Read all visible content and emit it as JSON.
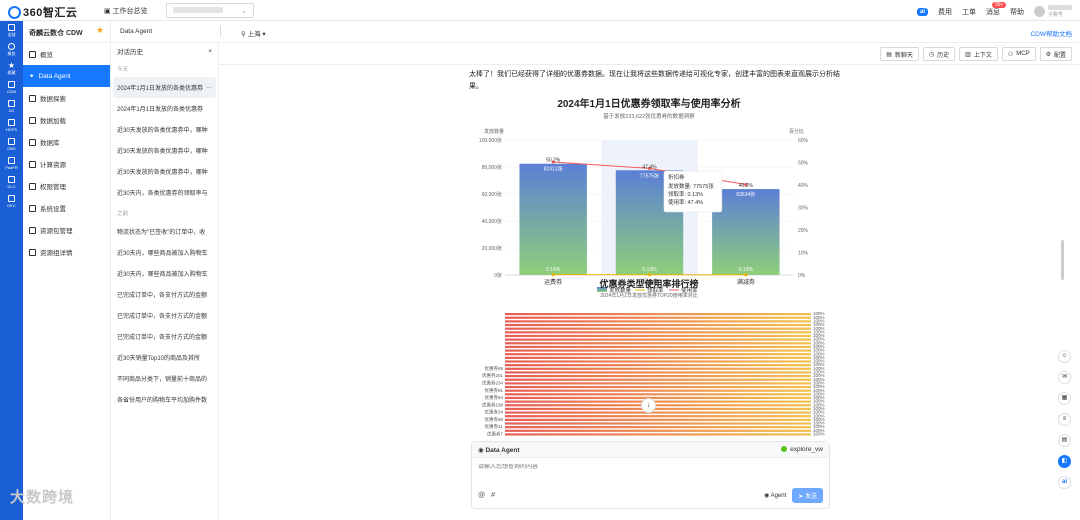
{
  "topbar": {
    "logo": "360智汇云",
    "workbench": "工作台总览",
    "links": [
      "费用",
      "工单",
      "消息",
      "帮助"
    ],
    "ai_label": "ai",
    "msg_count": "99+",
    "sub_account": "子账号"
  },
  "rail": [
    "全部",
    "概览",
    "收藏",
    "CDW",
    "DC",
    "HDFS",
    "OBS",
    "PaaFR",
    "DLC",
    "DKC"
  ],
  "sidebar": {
    "title": "奇麟云数仓 CDW",
    "items": [
      "概览",
      "Data Agent",
      "数据探索",
      "数据加载",
      "数据库",
      "计算资源",
      "权限管理",
      "系统设置",
      "资源包管理",
      "资源组详情"
    ]
  },
  "subbar": {
    "crumb": "Data Agent",
    "location": "上海",
    "help": "CDW帮助文档"
  },
  "convbar": {
    "name": "explore_vw",
    "actions": [
      "新聊天",
      "历史",
      "上下文",
      "MCP",
      "配置"
    ]
  },
  "history": {
    "title": "对话历史",
    "today_label": "今天",
    "today": [
      "2024年1月1日发放的各类优惠券",
      "2024年1月1日发放的各类优惠券",
      "近30天发放的各类优惠券中，哪种",
      "近30天发放的各类优惠券中，哪种",
      "近30天发放的各类优惠券中，哪种",
      "近30天内，各类优惠券的领取率与"
    ],
    "earlier_label": "之前",
    "earlier": [
      "物流状态为\"已签收\"的订单中，收",
      "近30天内，哪些商品被加入购物车",
      "近30天内，哪些商品被加入购物车",
      "已完成订单中，各支付方式的金额",
      "已完成订单中，各支付方式的金额",
      "已完成订单中，各支付方式的金额",
      "近30天销量Top10的商品及其所",
      "不同商品分类下，销量前十商品的",
      "各省份用户的购物车平均加购件数"
    ]
  },
  "intro": "太棒了！我们已经获得了详细的优惠券数据。现在让我将这些数据传递给可视化专家，创建丰富的图表来直观展示分析结果。",
  "chart_data": [
    {
      "type": "bar",
      "title": "2024年1月1日优惠券领取率与使用率分析",
      "subtitle": "基于发放223,622张优惠券的数据洞察",
      "ylabel": "发放数量",
      "y2label": "百分比",
      "categories": [
        "运费券",
        "折扣券",
        "满减券"
      ],
      "ylim": [
        0,
        100000
      ],
      "y2lim": [
        0,
        60
      ],
      "yticks": [
        "100,000张",
        "80,000张",
        "60,000张",
        "40,000张",
        "20,000张",
        "0张"
      ],
      "y2ticks": [
        "60%",
        "50%",
        "40%",
        "30%",
        "20%",
        "10%",
        "0%"
      ],
      "series": [
        {
          "name": "发放数量",
          "kind": "bar",
          "values": [
            82413,
            77575,
            63634
          ],
          "labels": [
            "82413张",
            "77575张",
            "63634张"
          ]
        },
        {
          "name": "领取率",
          "kind": "line",
          "values": [
            0.14,
            0.13,
            0.13
          ],
          "labels": [
            "0.14%",
            "0.13%",
            "0.13%"
          ]
        },
        {
          "name": "使用率",
          "kind": "line",
          "values": [
            50.2,
            47.4,
            40.2
          ],
          "labels": [
            "50.2%",
            "47.4%",
            "40.2%"
          ]
        }
      ],
      "tooltip": {
        "title": "折扣券",
        "lines": [
          "发放数量: 77575张",
          "领取率: 0.13%",
          "使用率: 47.4%"
        ]
      },
      "colors": {
        "bar_top": "#5b7fd6",
        "bar_bottom": "#8ecf7a",
        "claim": "#f0b400",
        "use": "#f25c5c"
      }
    },
    {
      "type": "bar",
      "title": "优惠券类型使用率排行榜",
      "subtitle": "2024年1月1日发放优惠券TOP20使用率对比",
      "categories": [
        "优惠券7",
        "优惠券21",
        "优惠券68",
        "优惠券34",
        "优惠券198",
        "优惠券84",
        "优惠券91",
        "优惠券234",
        "优惠券201",
        "优惠券69"
      ],
      "values": [
        100,
        100,
        100,
        100,
        100,
        100,
        100,
        100,
        100,
        100
      ],
      "value_label": "100%",
      "colors": {
        "start": "#e85b55",
        "end": "#f2c14e"
      }
    }
  ],
  "agent_box": {
    "title": "Data Agent",
    "workspace": "explore_vw",
    "placeholder": "请输入您想查询的内容",
    "mode": "Agent",
    "send": "发送"
  },
  "watermark": "大数跨境"
}
